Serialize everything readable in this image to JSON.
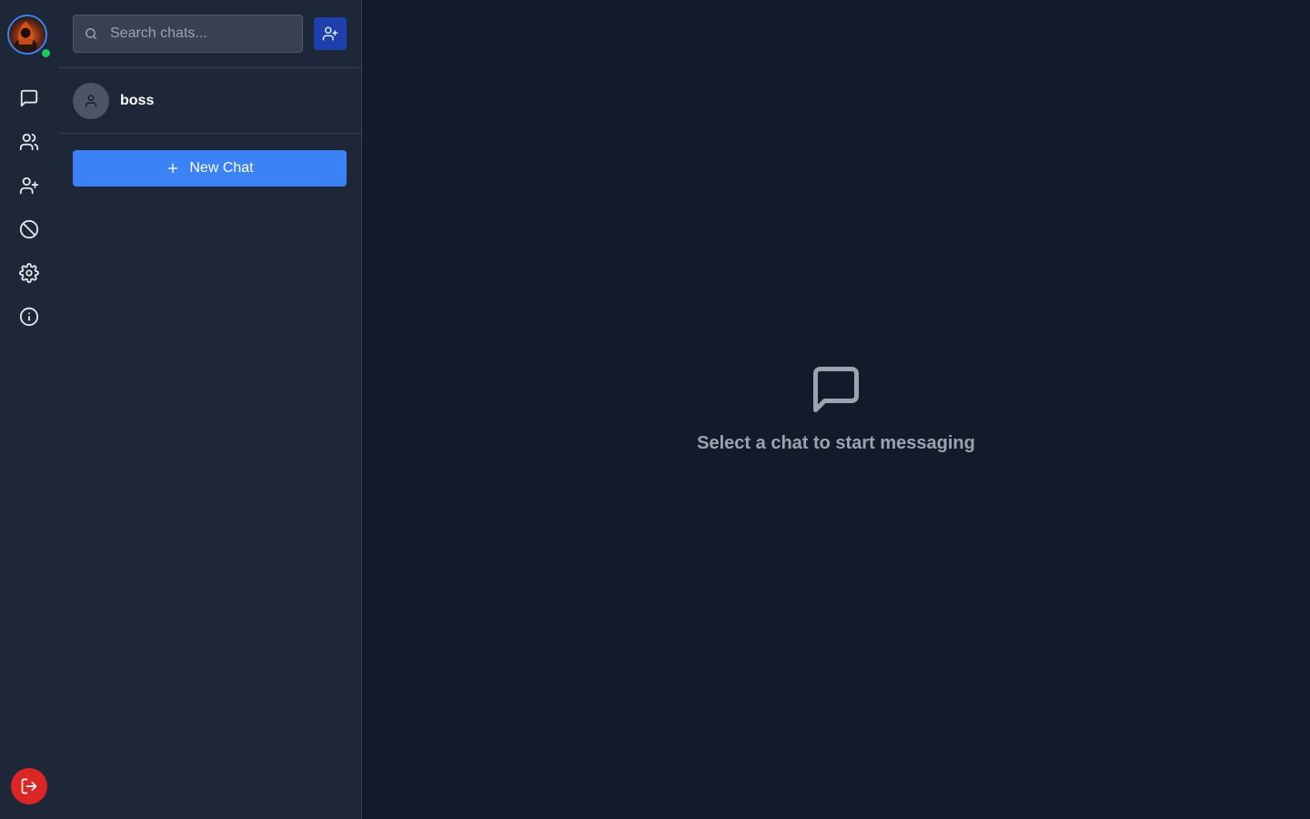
{
  "rail": {
    "avatar_alt": "User avatar",
    "status": "online",
    "items": [
      {
        "icon": "message-square-icon"
      },
      {
        "icon": "users-icon"
      },
      {
        "icon": "user-plus-icon"
      },
      {
        "icon": "ban-icon"
      },
      {
        "icon": "settings-icon"
      },
      {
        "icon": "info-icon"
      }
    ],
    "logout_icon": "log-out-icon"
  },
  "panel": {
    "search_placeholder": "Search chats...",
    "add_friend_icon": "user-plus-icon",
    "chats": [
      {
        "name": "boss",
        "avatar_icon": "user-icon"
      }
    ],
    "new_chat_label": "New Chat"
  },
  "main": {
    "empty_icon": "message-square-icon",
    "empty_text": "Select a chat to start messaging"
  },
  "colors": {
    "background": "#131a2a",
    "panel": "#1e2738",
    "accent": "#3b82f6",
    "danger": "#dc2626",
    "online": "#22c55e"
  }
}
